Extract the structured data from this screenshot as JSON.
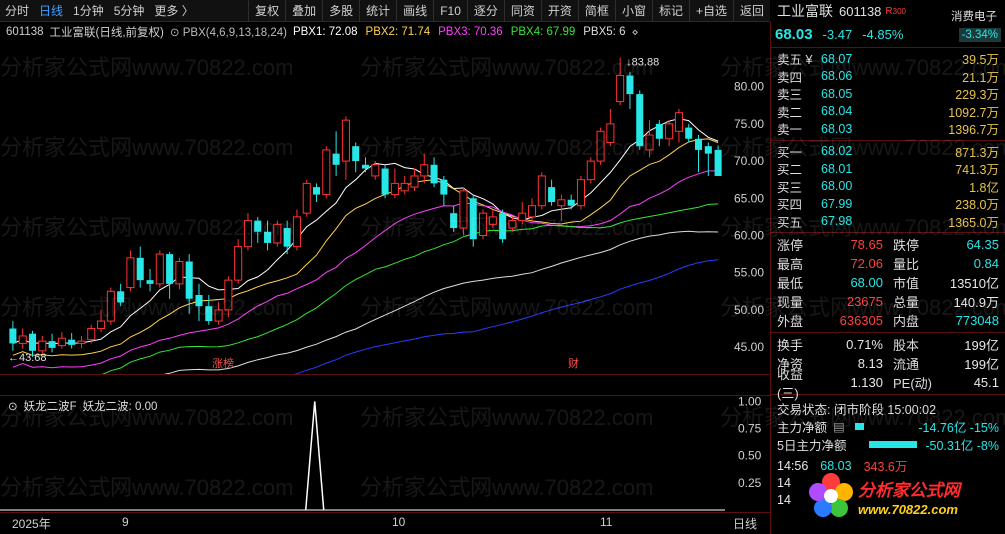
{
  "toolbar": {
    "periods": [
      "分时",
      "日线",
      "1分钟",
      "5分钟",
      "更多 〉"
    ],
    "active_period": "日线",
    "buttons": [
      "复权",
      "叠加",
      "多股",
      "统计",
      "画线",
      "F10",
      "逐分",
      "同资",
      "开资",
      "简框",
      "小窗",
      "标记",
      "+自选",
      "返回"
    ]
  },
  "main_legend": {
    "code": "601138",
    "name": "工业富联(日线,前复权)",
    "indicator": "PBX(4,6,9,13,18,24)",
    "pbx": [
      {
        "label": "PBX1: 72.08",
        "color": "#ffffff"
      },
      {
        "label": "PBX2: 71.74",
        "color": "#ffd24a"
      },
      {
        "label": "PBX3: 70.36",
        "color": "#ff40ff"
      },
      {
        "label": "PBX4: 67.99",
        "color": "#32e632"
      },
      {
        "label": "PBX5: 6",
        "color": "#dddddd"
      }
    ]
  },
  "price_axis": [
    "80.00",
    "75.00",
    "70.00",
    "65.00",
    "60.00",
    "55.00",
    "50.00",
    "45.00"
  ],
  "sub_axis": [
    "1.00",
    "0.75",
    "0.50",
    "0.25"
  ],
  "annotations": {
    "high": "83.88",
    "low": "43.68",
    "tag1": "涨榜",
    "tag2": "财"
  },
  "sub_legend": {
    "name": "妖龙二波F",
    "value_label": "妖龙二波: 0.00"
  },
  "date_axis": {
    "labels": [
      "2025年",
      "9",
      "10",
      "11"
    ],
    "mode": "日线"
  },
  "panel": {
    "name": "工业富联",
    "code": "601138",
    "r_tag": "R",
    "r_num": "300",
    "sector": "消费电子",
    "sector_pct": "-3.34%",
    "price": "68.03",
    "change": "-3.47",
    "change_pct": "-4.85%",
    "asks": [
      {
        "label": "卖五 ¥",
        "price": "68.07",
        "vol": "39.5万"
      },
      {
        "label": "卖四",
        "price": "68.06",
        "vol": "21.1万"
      },
      {
        "label": "卖三",
        "price": "68.05",
        "vol": "229.3万"
      },
      {
        "label": "卖二",
        "price": "68.04",
        "vol": "1092.7万"
      },
      {
        "label": "卖一",
        "price": "68.03",
        "vol": "1396.7万"
      }
    ],
    "bids": [
      {
        "label": "买一",
        "price": "68.02",
        "vol": "871.3万"
      },
      {
        "label": "买二",
        "price": "68.01",
        "vol": "741.3万"
      },
      {
        "label": "买三",
        "price": "68.00",
        "vol": "1.8亿"
      },
      {
        "label": "买四",
        "price": "67.99",
        "vol": "238.0万"
      },
      {
        "label": "买五",
        "price": "67.98",
        "vol": "1365.0万"
      }
    ],
    "stats1": [
      {
        "k": "涨停",
        "v": "78.65",
        "vc": "red",
        "k2": "跌停",
        "v2": "64.35",
        "v2c": "cyan"
      },
      {
        "k": "最高",
        "v": "72.06",
        "vc": "red",
        "k2": "量比",
        "v2": "0.84",
        "v2c": "cyan"
      },
      {
        "k": "最低",
        "v": "68.00",
        "vc": "cyan",
        "k2": "市值",
        "v2": "13510亿",
        "v2c": "white"
      },
      {
        "k": "现量",
        "v": "23675",
        "vc": "red",
        "k2": "总量",
        "v2": "140.9万",
        "v2c": "white"
      },
      {
        "k": "外盘",
        "v": "636305",
        "vc": "red",
        "k2": "内盘",
        "v2": "773048",
        "v2c": "cyan"
      }
    ],
    "stats2": [
      {
        "k": "换手",
        "v": "0.71%",
        "vc": "white",
        "k2": "股本",
        "v2": "199亿",
        "v2c": "white"
      },
      {
        "k": "净资",
        "v": "8.13",
        "vc": "white",
        "k2": "流通",
        "v2": "199亿",
        "v2c": "white"
      },
      {
        "k": "收益(三)",
        "v": "1.130",
        "vc": "white",
        "k2": "PE(动)",
        "v2": "45.1",
        "v2c": "white"
      }
    ],
    "trade_status": "交易状态: 闭市阶段 15:00:02",
    "flows": [
      {
        "label": "主力净额",
        "value": "-14.76亿 -15%",
        "bar_fraction": 0.15
      },
      {
        "label": "5日主力净额",
        "value": "-50.31亿 -8%",
        "bar_fraction": 0.8
      }
    ],
    "tick": {
      "time": "14:56",
      "price": "68.03",
      "vol": "343.6万"
    },
    "tick_rows_partial": [
      "14",
      "14"
    ]
  },
  "logo": {
    "title": "分析家公式网",
    "url": "www.70822.com"
  },
  "watermark": "分析家公式网www.70822.com",
  "chart_data": {
    "type": "candlestick",
    "ylim": [
      43,
      86
    ],
    "candles": [
      {
        "o": 47.5,
        "c": 45.5,
        "h": 48.5,
        "l": 44.5
      },
      {
        "o": 45.5,
        "c": 46.5,
        "h": 47.5,
        "l": 44.8
      },
      {
        "o": 46.8,
        "c": 44.5,
        "h": 47.2,
        "l": 43.7
      },
      {
        "o": 44.5,
        "c": 45.8,
        "h": 46.5,
        "l": 44.2
      },
      {
        "o": 45.8,
        "c": 44.9,
        "h": 46.8,
        "l": 44.3
      },
      {
        "o": 45.2,
        "c": 46.2,
        "h": 47.0,
        "l": 44.8
      },
      {
        "o": 46.0,
        "c": 45.3,
        "h": 46.9,
        "l": 44.8
      },
      {
        "o": 45.5,
        "c": 45.8,
        "h": 46.5,
        "l": 44.9
      },
      {
        "o": 46.0,
        "c": 47.5,
        "h": 48.0,
        "l": 45.5
      },
      {
        "o": 47.5,
        "c": 48.5,
        "h": 50.0,
        "l": 47.0
      },
      {
        "o": 48.5,
        "c": 52.5,
        "h": 53.0,
        "l": 48.0
      },
      {
        "o": 52.5,
        "c": 51.0,
        "h": 53.5,
        "l": 50.5
      },
      {
        "o": 53.0,
        "c": 57.0,
        "h": 58.0,
        "l": 52.5
      },
      {
        "o": 57.0,
        "c": 54.0,
        "h": 58.5,
        "l": 53.0
      },
      {
        "o": 54.0,
        "c": 53.5,
        "h": 55.5,
        "l": 52.5
      },
      {
        "o": 53.5,
        "c": 57.5,
        "h": 58.0,
        "l": 53.0
      },
      {
        "o": 57.5,
        "c": 53.5,
        "h": 57.8,
        "l": 51.5
      },
      {
        "o": 53.5,
        "c": 56.5,
        "h": 57.0,
        "l": 52.8
      },
      {
        "o": 56.5,
        "c": 51.5,
        "h": 57.5,
        "l": 49.5
      },
      {
        "o": 52.0,
        "c": 50.5,
        "h": 53.5,
        "l": 48.5
      },
      {
        "o": 50.5,
        "c": 48.5,
        "h": 52.0,
        "l": 48.0
      },
      {
        "o": 48.5,
        "c": 50.0,
        "h": 51.0,
        "l": 48.0
      },
      {
        "o": 50.0,
        "c": 54.0,
        "h": 54.5,
        "l": 49.0
      },
      {
        "o": 54.0,
        "c": 58.5,
        "h": 59.5,
        "l": 53.5
      },
      {
        "o": 58.5,
        "c": 62.0,
        "h": 63.0,
        "l": 58.0
      },
      {
        "o": 62.0,
        "c": 60.5,
        "h": 62.5,
        "l": 59.0
      },
      {
        "o": 60.5,
        "c": 59.0,
        "h": 62.0,
        "l": 58.0
      },
      {
        "o": 59.0,
        "c": 61.5,
        "h": 62.0,
        "l": 58.5
      },
      {
        "o": 61.0,
        "c": 58.5,
        "h": 62.0,
        "l": 57.5
      },
      {
        "o": 58.5,
        "c": 62.5,
        "h": 63.5,
        "l": 58.0
      },
      {
        "o": 63.0,
        "c": 67.0,
        "h": 67.5,
        "l": 62.5
      },
      {
        "o": 66.5,
        "c": 65.5,
        "h": 67.0,
        "l": 64.5
      },
      {
        "o": 65.5,
        "c": 71.5,
        "h": 72.0,
        "l": 65.0
      },
      {
        "o": 71.0,
        "c": 69.5,
        "h": 74.0,
        "l": 68.0
      },
      {
        "o": 70.0,
        "c": 75.5,
        "h": 76.0,
        "l": 67.5
      },
      {
        "o": 72.0,
        "c": 70.0,
        "h": 72.5,
        "l": 68.5
      },
      {
        "o": 69.5,
        "c": 69.0,
        "h": 70.5,
        "l": 68.5
      },
      {
        "o": 68.0,
        "c": 69.5,
        "h": 70.0,
        "l": 67.5
      },
      {
        "o": 69.0,
        "c": 65.5,
        "h": 69.5,
        "l": 65.0
      },
      {
        "o": 65.5,
        "c": 67.0,
        "h": 69.0,
        "l": 65.0
      },
      {
        "o": 66.0,
        "c": 67.0,
        "h": 68.0,
        "l": 65.5
      },
      {
        "o": 66.5,
        "c": 68.0,
        "h": 69.0,
        "l": 66.0
      },
      {
        "o": 68.0,
        "c": 69.5,
        "h": 71.0,
        "l": 67.0
      },
      {
        "o": 69.5,
        "c": 67.0,
        "h": 70.5,
        "l": 66.5
      },
      {
        "o": 67.5,
        "c": 65.5,
        "h": 68.0,
        "l": 64.0
      },
      {
        "o": 63.0,
        "c": 61.0,
        "h": 64.0,
        "l": 60.5
      },
      {
        "o": 61.0,
        "c": 66.0,
        "h": 66.5,
        "l": 60.0
      },
      {
        "o": 65.0,
        "c": 59.5,
        "h": 65.5,
        "l": 58.5
      },
      {
        "o": 60.0,
        "c": 63.0,
        "h": 63.5,
        "l": 59.5
      },
      {
        "o": 61.5,
        "c": 62.5,
        "h": 63.5,
        "l": 61.0
      },
      {
        "o": 63.0,
        "c": 59.5,
        "h": 63.5,
        "l": 59.0
      },
      {
        "o": 61.0,
        "c": 62.0,
        "h": 62.5,
        "l": 60.5
      },
      {
        "o": 62.0,
        "c": 63.0,
        "h": 64.5,
        "l": 61.5
      },
      {
        "o": 62.5,
        "c": 64.0,
        "h": 65.0,
        "l": 62.0
      },
      {
        "o": 64.0,
        "c": 68.0,
        "h": 68.5,
        "l": 63.5
      },
      {
        "o": 66.5,
        "c": 64.5,
        "h": 67.5,
        "l": 64.0
      },
      {
        "o": 64.0,
        "c": 64.8,
        "h": 65.5,
        "l": 62.0
      },
      {
        "o": 64.8,
        "c": 64.0,
        "h": 65.5,
        "l": 63.5
      },
      {
        "o": 64.0,
        "c": 67.5,
        "h": 68.0,
        "l": 63.5
      },
      {
        "o": 67.5,
        "c": 70.0,
        "h": 70.5,
        "l": 67.0
      },
      {
        "o": 70.0,
        "c": 74.0,
        "h": 74.5,
        "l": 69.5
      },
      {
        "o": 72.5,
        "c": 75.0,
        "h": 77.0,
        "l": 72.0
      },
      {
        "o": 78.0,
        "c": 81.5,
        "h": 83.9,
        "l": 77.5
      },
      {
        "o": 81.5,
        "c": 79.0,
        "h": 82.0,
        "l": 77.0
      },
      {
        "o": 79.0,
        "c": 72.0,
        "h": 79.5,
        "l": 71.5
      },
      {
        "o": 71.5,
        "c": 73.5,
        "h": 75.5,
        "l": 70.5
      },
      {
        "o": 75.0,
        "c": 73.0,
        "h": 75.5,
        "l": 72.0
      },
      {
        "o": 73.0,
        "c": 75.0,
        "h": 75.5,
        "l": 72.0
      },
      {
        "o": 74.0,
        "c": 76.5,
        "h": 77.0,
        "l": 72.5
      },
      {
        "o": 74.5,
        "c": 73.0,
        "h": 75.0,
        "l": 72.5
      },
      {
        "o": 73.0,
        "c": 71.5,
        "h": 73.5,
        "l": 68.5
      },
      {
        "o": 72.0,
        "c": 71.0,
        "h": 72.5,
        "l": 68.0
      },
      {
        "o": 71.5,
        "c": 68.0,
        "h": 72.1,
        "l": 68.0
      }
    ],
    "ma_colors": [
      "#ffffff",
      "#ffd24a",
      "#ff40ff",
      "#32e632",
      "#dddddd",
      "#2c3cff"
    ],
    "sub_series": {
      "ylim": [
        0,
        1.05
      ],
      "spike_index": 30,
      "spike_value": 1.0
    }
  }
}
